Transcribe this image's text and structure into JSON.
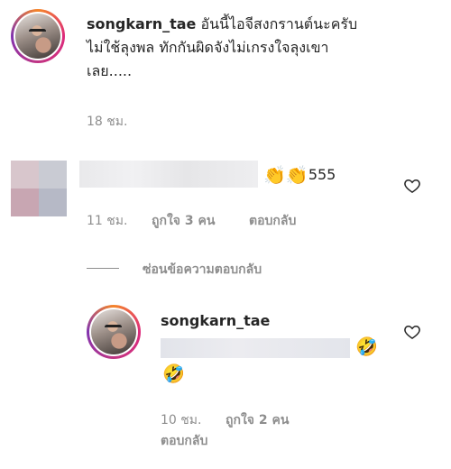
{
  "post_comment": {
    "username": "songkarn_tae",
    "text_line1": "อันนี้ไอจีสงกรานต์นะครับ",
    "text_line2": "ไม่ใช้ลุงพล ทักกันผิดจังไม่เกรงใจลุงเขา",
    "text_line3": "เลย.....",
    "time": "18 ชม."
  },
  "reply_comment": {
    "text": "555",
    "time": "11 ชม.",
    "likes": "ถูกใจ 3 คน",
    "reply_label": "ตอบกลับ",
    "emoji_icon": "clapping-hands-icon"
  },
  "hide_replies_label": "ซ่อนข้อความตอบกลับ",
  "nested_reply": {
    "username": "songkarn_tae",
    "time": "10 ชม.",
    "likes": "ถูกใจ 2 คน",
    "reply_label": "ตอบกลับ",
    "emoji_icon": "rolling-laughing-face-icon"
  },
  "colors": {
    "meta_text": "#8e8e8e",
    "primary_text": "#262626",
    "redacted_block": "#e7e7e9"
  }
}
